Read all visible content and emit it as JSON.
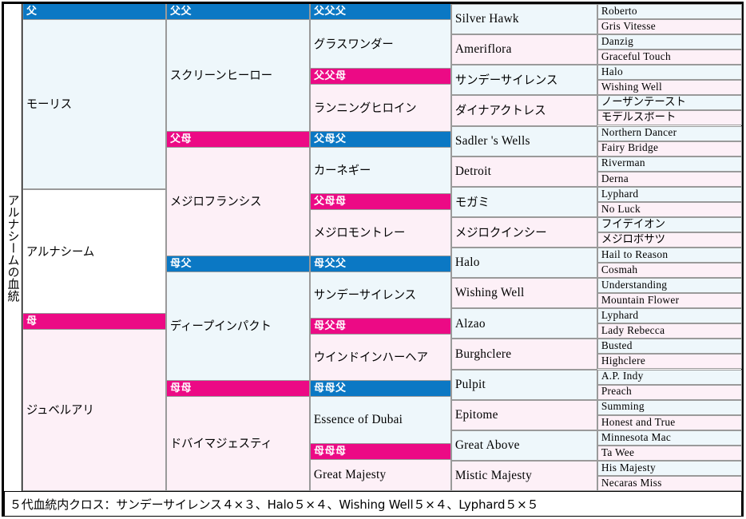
{
  "title": {
    "vertical_label": "アルナシームの血統"
  },
  "headers": {
    "gen1_sire": "父",
    "gen1_dam": "母",
    "gen2_sire_sire": "父父",
    "gen2_sire_dam": "父母",
    "gen2_dam_sire": "母父",
    "gen2_dam_dam": "母母",
    "gen3_ss_s": "父父父",
    "gen3_ss_d": "父父母",
    "gen3_sd_s": "父母父",
    "gen3_sd_d": "父母母",
    "gen3_ds_s": "母父父",
    "gen3_ds_d": "母父母",
    "gen3_dd_s": "母母父",
    "gen3_dd_d": "母母母"
  },
  "gen1": [
    {
      "name": "モーリス",
      "type": "sire",
      "script": "jp"
    },
    {
      "name": "ジュベルアリ",
      "type": "dam",
      "script": "jp"
    }
  ],
  "gen1_middle": {
    "name": "アルナシーム",
    "script": "jp"
  },
  "gen2": [
    {
      "name": "スクリーンヒーロー",
      "type": "sire",
      "script": "jp"
    },
    {
      "name": "メジロフランシス",
      "type": "dam",
      "script": "jp"
    },
    {
      "name": "ディープインパクト",
      "type": "sire",
      "script": "jp"
    },
    {
      "name": "ドバイマジェスティ",
      "type": "dam",
      "script": "jp"
    }
  ],
  "gen3": [
    {
      "name": "グラスワンダー",
      "type": "sire",
      "script": "jp"
    },
    {
      "name": "ランニングヒロイン",
      "type": "dam",
      "script": "jp"
    },
    {
      "name": "カーネギー",
      "type": "sire",
      "script": "jp"
    },
    {
      "name": "メジロモントレー",
      "type": "dam",
      "script": "jp"
    },
    {
      "name": "サンデーサイレンス",
      "type": "sire",
      "script": "jp"
    },
    {
      "name": "ウインドインハーヘア",
      "type": "dam",
      "script": "jp"
    },
    {
      "name": "Essence of Dubai",
      "type": "sire",
      "script": "en"
    },
    {
      "name": "Great Majesty",
      "type": "dam",
      "script": "en"
    }
  ],
  "gen4": [
    {
      "name": "Silver Hawk",
      "type": "sire",
      "script": "en"
    },
    {
      "name": "Ameriflora",
      "type": "dam",
      "script": "en"
    },
    {
      "name": "サンデーサイレンス",
      "type": "sire",
      "script": "jp"
    },
    {
      "name": "ダイナアクトレス",
      "type": "dam",
      "script": "jp"
    },
    {
      "name": "Sadler 's Wells",
      "type": "sire",
      "script": "en"
    },
    {
      "name": "Detroit",
      "type": "dam",
      "script": "en"
    },
    {
      "name": "モガミ",
      "type": "sire",
      "script": "jp"
    },
    {
      "name": "メジロクインシー",
      "type": "dam",
      "script": "jp"
    },
    {
      "name": "Halo",
      "type": "sire",
      "script": "en"
    },
    {
      "name": "Wishing Well",
      "type": "dam",
      "script": "en"
    },
    {
      "name": "Alzao",
      "type": "sire",
      "script": "en"
    },
    {
      "name": "Burghclere",
      "type": "dam",
      "script": "en"
    },
    {
      "name": "Pulpit",
      "type": "sire",
      "script": "en"
    },
    {
      "name": "Epitome",
      "type": "dam",
      "script": "en"
    },
    {
      "name": "Great Above",
      "type": "sire",
      "script": "en"
    },
    {
      "name": "Mistic Majesty",
      "type": "dam",
      "script": "en"
    }
  ],
  "gen5": [
    {
      "name": "Roberto",
      "type": "sire",
      "script": "en"
    },
    {
      "name": "Gris Vitesse",
      "type": "dam",
      "script": "en"
    },
    {
      "name": "Danzig",
      "type": "sire",
      "script": "en"
    },
    {
      "name": "Graceful Touch",
      "type": "dam",
      "script": "en"
    },
    {
      "name": "Halo",
      "type": "sire",
      "script": "en"
    },
    {
      "name": "Wishing Well",
      "type": "dam",
      "script": "en"
    },
    {
      "name": "ノーザンテースト",
      "type": "sire",
      "script": "jp"
    },
    {
      "name": "モデルスポート",
      "type": "dam",
      "script": "jp"
    },
    {
      "name": "Northern Dancer",
      "type": "sire",
      "script": "en"
    },
    {
      "name": "Fairy Bridge",
      "type": "dam",
      "script": "en"
    },
    {
      "name": "Riverman",
      "type": "sire",
      "script": "en"
    },
    {
      "name": "Derna",
      "type": "dam",
      "script": "en"
    },
    {
      "name": "Lyphard",
      "type": "sire",
      "script": "en"
    },
    {
      "name": "No Luck",
      "type": "dam",
      "script": "en"
    },
    {
      "name": "フイデイオン",
      "type": "sire",
      "script": "jp"
    },
    {
      "name": "メジロボサツ",
      "type": "dam",
      "script": "jp"
    },
    {
      "name": "Hail to Reason",
      "type": "sire",
      "script": "en"
    },
    {
      "name": "Cosmah",
      "type": "dam",
      "script": "en"
    },
    {
      "name": "Understanding",
      "type": "sire",
      "script": "en"
    },
    {
      "name": "Mountain Flower",
      "type": "dam",
      "script": "en"
    },
    {
      "name": "Lyphard",
      "type": "sire",
      "script": "en"
    },
    {
      "name": "Lady Rebecca",
      "type": "dam",
      "script": "en"
    },
    {
      "name": "Busted",
      "type": "sire",
      "script": "en"
    },
    {
      "name": "Highclere",
      "type": "dam",
      "script": "en"
    },
    {
      "name": "A.P. Indy",
      "type": "sire",
      "script": "en"
    },
    {
      "name": "Preach",
      "type": "dam",
      "script": "en"
    },
    {
      "name": "Summing",
      "type": "sire",
      "script": "en"
    },
    {
      "name": "Honest and True",
      "type": "dam",
      "script": "en"
    },
    {
      "name": "Minnesota Mac",
      "type": "sire",
      "script": "en"
    },
    {
      "name": "Ta Wee",
      "type": "dam",
      "script": "en"
    },
    {
      "name": "His Majesty",
      "type": "sire",
      "script": "en"
    },
    {
      "name": "Necaras Miss",
      "type": "dam",
      "script": "en"
    }
  ],
  "footer": {
    "note": "５代血統内クロス：サンデーサイレンス４×３、Halo５×４、Wishing Well５×４、Lyphard５×５"
  },
  "colors": {
    "sire_header": "#0b78c4",
    "dam_header": "#ec0a85",
    "sire_cell": "#eef7fb",
    "dam_cell": "#fdf0f7",
    "border": "#9a9a9a",
    "frame": "#000000"
  }
}
